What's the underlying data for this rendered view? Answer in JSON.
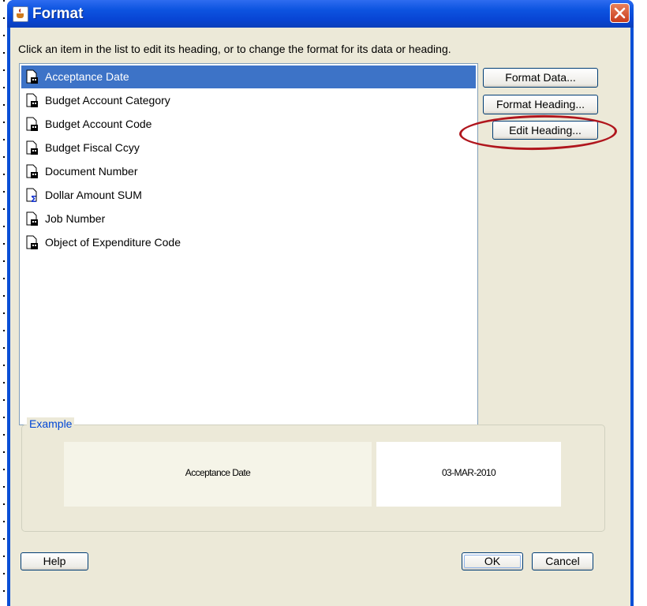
{
  "window": {
    "title": "Format"
  },
  "instructions": "Click an item in the list to edit its heading, or to change the format for its data or heading.",
  "list": {
    "items": [
      {
        "label": "Acceptance Date",
        "icon": "field-icon",
        "selected": true
      },
      {
        "label": "Budget Account Category",
        "icon": "field-icon",
        "selected": false
      },
      {
        "label": "Budget Account Code",
        "icon": "field-icon",
        "selected": false
      },
      {
        "label": "Budget Fiscal Ccyy",
        "icon": "field-icon",
        "selected": false
      },
      {
        "label": "Document Number",
        "icon": "field-icon",
        "selected": false
      },
      {
        "label": "Dollar Amount SUM",
        "icon": "sum-field-icon",
        "selected": false
      },
      {
        "label": "Job Number",
        "icon": "field-icon",
        "selected": false
      },
      {
        "label": "Object of Expenditure Code",
        "icon": "field-icon",
        "selected": false
      }
    ]
  },
  "buttons": {
    "format_data": "Format  Data...",
    "format_heading": "Format Heading...",
    "edit_heading": "Edit Heading...",
    "help": "Help",
    "ok": "OK",
    "cancel": "Cancel"
  },
  "example": {
    "label": "Example",
    "heading_text": "Acceptance Date",
    "data_text": "03-MAR-2010"
  },
  "colors": {
    "title_bar": "#0a4fd6",
    "selection": "#3d73c7",
    "annotation": "#b0161d",
    "example_label": "#0046d5"
  }
}
